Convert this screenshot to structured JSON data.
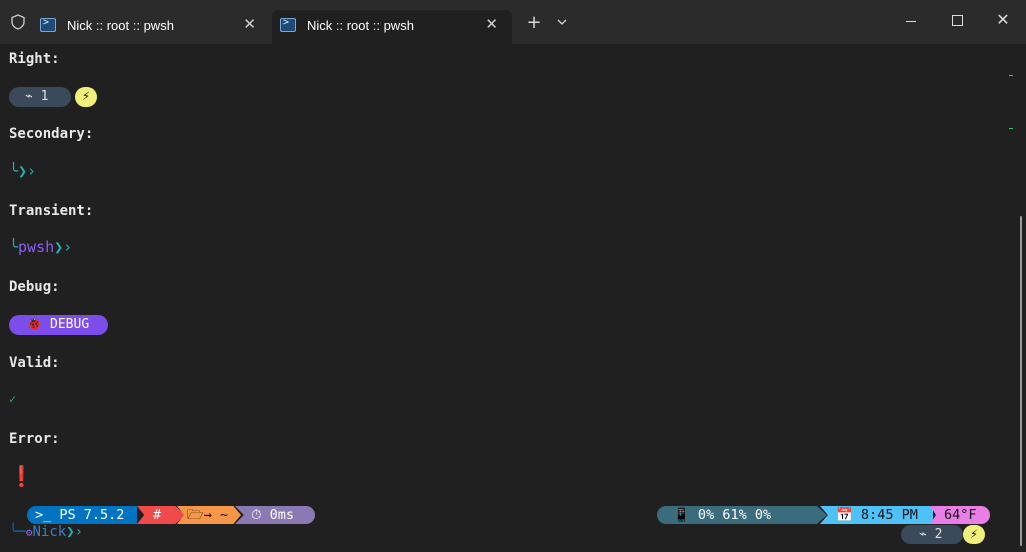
{
  "tabs": [
    {
      "label": "Nick :: root :: pwsh",
      "active": false
    },
    {
      "label": "Nick :: root :: pwsh",
      "active": true
    }
  ],
  "titlebar": {
    "new_tab": "+",
    "dropdown": "⌄",
    "close_tab": "✕",
    "window_close": "✕"
  },
  "terminal": {
    "right_label": "Right:",
    "right_exec_count": "⌁ 1",
    "bolt_glyph": "⚡",
    "secondary_label": "Secondary:",
    "secondary_prompt": "╰❯›",
    "transient_label": "Transient:",
    "transient_prefix": "╰",
    "transient_shell": "pwsh",
    "transient_arrow": "❯›",
    "debug_label": "Debug:",
    "debug_text": "🐞 DEBUG",
    "valid_label": "Valid:",
    "valid_mark": "✓",
    "error_label": "Error:",
    "error_mark": "❗"
  },
  "prompt": {
    "ps_version": ">_ PS 7.5.2",
    "root": "#",
    "path": "🗁→ ~",
    "duration": "⏱ 0ms",
    "system": "📱 0%  61%  0%",
    "clock": "📅 8:45 PM",
    "weather": "64°F",
    "line_prefix": "╰─",
    "user_gear": "⚙",
    "user": "Nick",
    "arrow": "❯›",
    "exec_count": "⌁ 2"
  },
  "colors": {
    "ps": "#0073c3",
    "root": "#f04a4a",
    "path": "#f79646",
    "time": "#8b79b3",
    "system": "#3b6c7e",
    "clock": "#4ec2f7",
    "weather": "#e97ee6",
    "debug": "#7c4deb",
    "teal": "#21b3b0"
  }
}
